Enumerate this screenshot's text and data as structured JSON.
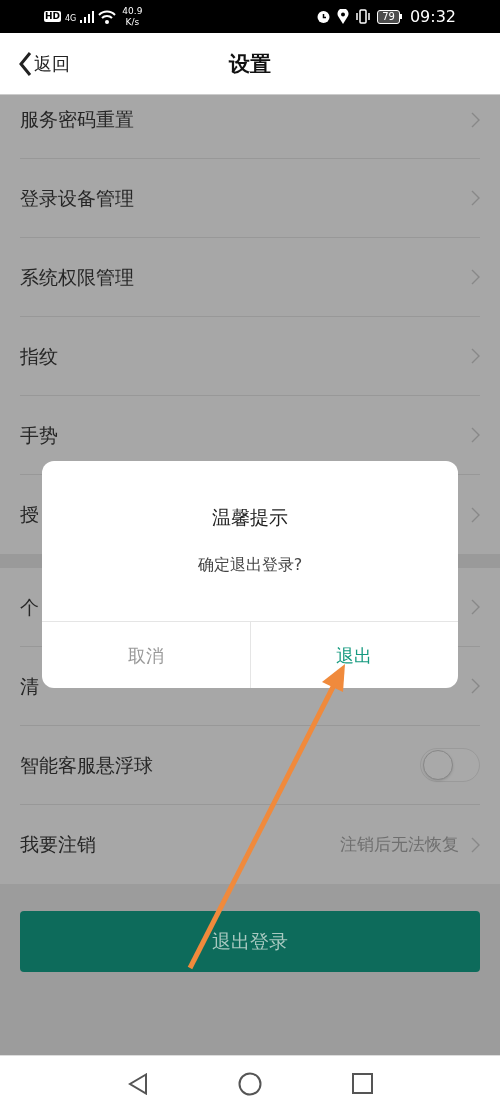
{
  "status_bar": {
    "hd": "HD",
    "network": "4G",
    "speed_value": "40.9",
    "speed_unit": "K/s",
    "battery": "79",
    "time": "09:32"
  },
  "header": {
    "back": "返回",
    "title": "设置"
  },
  "groups": [
    {
      "rows": [
        {
          "kind": "link",
          "label": "服务密码重置"
        },
        {
          "kind": "link",
          "label": "登录设备管理"
        },
        {
          "kind": "link",
          "label": "系统权限管理"
        },
        {
          "kind": "link",
          "label": "指纹"
        },
        {
          "kind": "link",
          "label": "手势"
        },
        {
          "kind": "link",
          "label": "授"
        }
      ]
    },
    {
      "rows": [
        {
          "kind": "link",
          "label": "个"
        },
        {
          "kind": "link",
          "label": "清"
        },
        {
          "kind": "toggle",
          "label": "智能客服悬浮球",
          "on": false
        },
        {
          "kind": "link",
          "label": "我要注销",
          "value": "注销后无法恢复"
        }
      ]
    }
  ],
  "logout_button": "退出登录",
  "dialog": {
    "title": "温馨提示",
    "message": "确定退出登录?",
    "buttons": [
      {
        "label": "取消",
        "primary": false
      },
      {
        "label": "退出",
        "primary": true
      }
    ]
  }
}
